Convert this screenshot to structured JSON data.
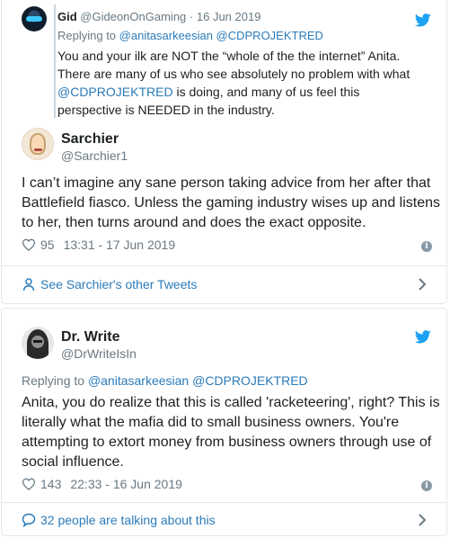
{
  "tweet1": {
    "quoted": {
      "name": "Gid",
      "handle": "@GideonOnGaming",
      "separator": "·",
      "date": "16 Jun 2019",
      "replying_prefix": "Replying to",
      "replying_handles": "@anitasarkeesian @CDPROJEKTRED",
      "text_1": "You and your ilk are NOT the “whole of the the internet” Anita. There are many of us who see absolutely no problem with what",
      "mention": "@CDPROJEKTRED",
      "text_2": "is doing, and many of us feel this perspective is NEEDED in the industry."
    },
    "author": {
      "name": "Sarchier",
      "handle": "@Sarchier1"
    },
    "text": "I can’t imagine any sane person taking advice from her after that Battlefield fiasco. Unless the gaming industry wises up and listens to her, then turns around and does the exact opposite.",
    "likes": "95",
    "timestamp": "13:31 - 17 Jun 2019",
    "footer_label": "See Sarchier's other Tweets"
  },
  "tweet2": {
    "author": {
      "name": "Dr. Write",
      "handle": "@DrWriteIsIn"
    },
    "replying_prefix": "Replying to",
    "replying_handles": "@anitasarkeesian @CDPROJEKTRED",
    "text": "Anita, you do realize that this is called 'racketeering', right? This is literally what the mafia did to small business owners. You're attempting to extort money from business owners through use of social influence.",
    "likes": "143",
    "timestamp": "22:33 - 16 Jun 2019",
    "footer_label": "32 people are talking about this"
  },
  "colors": {
    "twitter_blue": "#1da1f2",
    "link_blue": "#2b7bb9",
    "muted": "#697882",
    "border": "#e1e8ed"
  },
  "icons": [
    "twitter-bird-icon",
    "heart-icon",
    "info-icon",
    "person-icon",
    "comment-icon",
    "chevron-right-icon"
  ]
}
